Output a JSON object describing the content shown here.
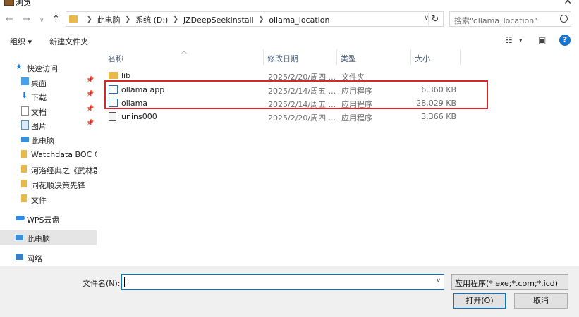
{
  "window": {
    "title": "浏览"
  },
  "address": {
    "crumbs": [
      "此电脑",
      "系统 (D:)",
      "JZDeepSeekInstall",
      "ollama_location"
    ]
  },
  "search": {
    "placeholder": "搜索\"ollama_location\""
  },
  "toolbar": {
    "organize": "组织 ▾",
    "new_folder": "新建文件夹"
  },
  "sidebar": {
    "items": [
      {
        "label": "快速访问",
        "icon": "star-icon"
      },
      {
        "label": "桌面",
        "icon": "desktop-folder-icon"
      },
      {
        "label": "下载",
        "icon": "download-folder-icon"
      },
      {
        "label": "文档",
        "icon": "documents-folder-icon"
      },
      {
        "label": "图片",
        "icon": "pictures-folder-icon"
      },
      {
        "label": "此电脑",
        "icon": "computer-icon"
      },
      {
        "label": "Watchdata BOC C",
        "icon": "folder-icon"
      },
      {
        "label": "河洛经典之《武林群",
        "icon": "folder-icon"
      },
      {
        "label": "同花顺决策先锋",
        "icon": "folder-icon"
      },
      {
        "label": "文件",
        "icon": "folder-icon"
      },
      {
        "label": "WPS云盘",
        "icon": "cloud-icon"
      },
      {
        "label": "此电脑",
        "icon": "computer-icon"
      },
      {
        "label": "网络",
        "icon": "network-icon"
      }
    ]
  },
  "columns": {
    "name": "名称",
    "date": "修改日期",
    "type": "类型",
    "size": "大小"
  },
  "files": [
    {
      "name": "lib",
      "date": "2025/2/20/周四 ...",
      "type": "文件夹",
      "size": "",
      "icon": "folder-icon"
    },
    {
      "name": "ollama app",
      "date": "2025/2/14/周五 ...",
      "type": "应用程序",
      "size": "6,360 KB",
      "icon": "app-icon"
    },
    {
      "name": "ollama",
      "date": "2025/2/14/周五 ...",
      "type": "应用程序",
      "size": "28,029 KB",
      "icon": "app-icon"
    },
    {
      "name": "unins000",
      "date": "2025/2/20/周四 ...",
      "type": "应用程序",
      "size": "3,366 KB",
      "icon": "uninstaller-icon"
    }
  ],
  "bottom": {
    "filename_label": "文件名(N):",
    "filename_value": "",
    "filter": "应用程序(*.exe;*.com;*.icd)",
    "open": "打开(O)",
    "cancel": "取消"
  },
  "colors": {
    "highlight_border": "#d9262c",
    "accent": "#0078d7",
    "folder": "#e8b94a"
  }
}
